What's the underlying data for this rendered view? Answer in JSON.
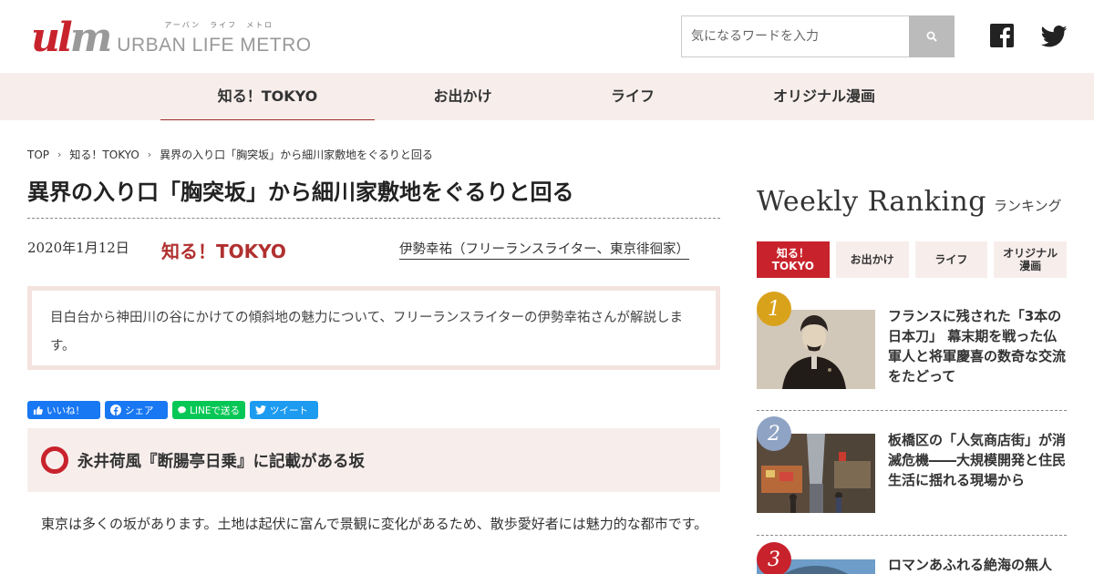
{
  "brand": {
    "logo_mark": "ulm",
    "logo_ruby": "アーバン　ライフ　メトロ",
    "logo_text": "URBAN LIFE METRO",
    "accent_color": "#c8232c"
  },
  "search": {
    "placeholder": "気になるワードを入力",
    "icon": "search-icon"
  },
  "social": {
    "facebook_icon": "facebook-icon",
    "twitter_icon": "twitter-icon"
  },
  "nav": {
    "items": [
      {
        "label": "知る！TOKYO",
        "active": true
      },
      {
        "label": "お出かけ",
        "active": false
      },
      {
        "label": "ライフ",
        "active": false
      },
      {
        "label": "オリジナル漫画",
        "active": false
      }
    ]
  },
  "breadcrumb": {
    "items": [
      "TOP",
      "知る！TOKYO",
      "異界の入り口「胸突坂」から細川家敷地をぐるりと回る"
    ]
  },
  "article": {
    "title": "異界の入り口「胸突坂」から細川家敷地をぐるりと回る",
    "date": "2020年1月12日",
    "category": "知る！TOKYO",
    "author": "伊勢幸祐（フリーランスライター、東京徘徊家）",
    "summary": "目白台から神田川の谷にかけての傾斜地の魅力について、フリーランスライターの伊勢幸祐さんが解説します。",
    "share": {
      "like": "いいね！",
      "share": "シェア",
      "line": "LINEで送る",
      "tweet": "ツイート"
    },
    "section_title": "永井荷風『断腸亭日乗』に記載がある坂",
    "body": "　東京は多くの坂があります。土地は起伏に富んで景観に変化があるため、散歩愛好者には魅力的な都市です。"
  },
  "ranking": {
    "title": "Weekly Ranking",
    "subtitle": "ランキング",
    "tabs": [
      {
        "label": "知る！\nTOKYO",
        "active": true
      },
      {
        "label": "お出かけ",
        "active": false
      },
      {
        "label": "ライフ",
        "active": false
      },
      {
        "label": "オリジナル\n漫画",
        "active": false
      }
    ],
    "items": [
      {
        "rank": "1",
        "color": "#d9a21b",
        "title": "フランスに残された「3本の日本刀」 幕末期を戦った仏軍人と将軍慶喜の数奇な交流をたどって"
      },
      {
        "rank": "2",
        "color": "#8fa3c4",
        "title": "板橋区の「人気商店街」が消滅危機――大規模開発と住民生活に揺れる現場から"
      },
      {
        "rank": "3",
        "color": "#c8232c",
        "title": "ロマンあふれる絶海の無人"
      }
    ]
  }
}
